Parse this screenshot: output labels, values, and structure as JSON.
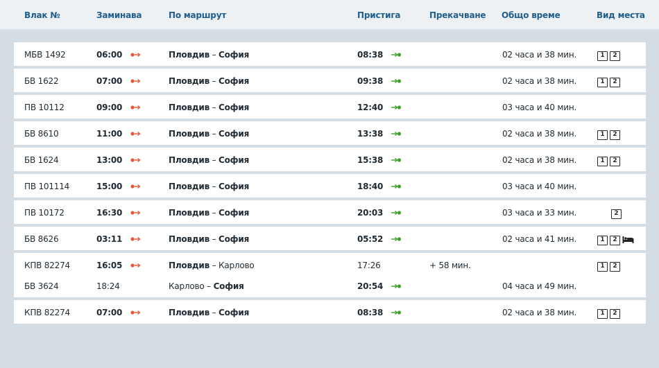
{
  "header": {
    "train": "Влак №",
    "departure": "Заминава",
    "route": "По маршрут",
    "arrival": "Пристига",
    "transfer": "Прекачване",
    "total_time": "Общо време",
    "seat_type": "Вид места"
  },
  "colors": {
    "header_text": "#1e5d8c",
    "depart_icon": "#e8553a",
    "arrive_icon": "#3fa028",
    "background": "#d5dde4"
  },
  "icons": {
    "depart": "departure-dot-arrow-icon",
    "arrive": "arrival-arrow-dot-icon",
    "bed": "sleeper-bed-icon"
  },
  "rows": [
    {
      "train": "МБВ 1492",
      "dep": "06:00",
      "route_from": "Пловдив",
      "route_sep": " – ",
      "route_to": "София",
      "arr": "08:38",
      "transfer": "",
      "total": "02 часа и 38 мин.",
      "seats": [
        "1",
        "2"
      ],
      "bed": false
    },
    {
      "train": "БВ 1622",
      "dep": "07:00",
      "route_from": "Пловдив",
      "route_sep": " – ",
      "route_to": "София",
      "arr": "09:38",
      "transfer": "",
      "total": "02 часа и 38 мин.",
      "seats": [
        "1",
        "2"
      ],
      "bed": false
    },
    {
      "train": "ПВ 10112",
      "dep": "09:00",
      "route_from": "Пловдив",
      "route_sep": " – ",
      "route_to": "София",
      "arr": "12:40",
      "transfer": "",
      "total": "03 часа и 40 мин.",
      "seats": [],
      "bed": false
    },
    {
      "train": "БВ 8610",
      "dep": "11:00",
      "route_from": "Пловдив",
      "route_sep": " – ",
      "route_to": "София",
      "arr": "13:38",
      "transfer": "",
      "total": "02 часа и 38 мин.",
      "seats": [
        "1",
        "2"
      ],
      "bed": false
    },
    {
      "train": "БВ 1624",
      "dep": "13:00",
      "route_from": "Пловдив",
      "route_sep": " – ",
      "route_to": "София",
      "arr": "15:38",
      "transfer": "",
      "total": "02 часа и 38 мин.",
      "seats": [
        "1",
        "2"
      ],
      "bed": false
    },
    {
      "train": "ПВ 101114",
      "dep": "15:00",
      "route_from": "Пловдив",
      "route_sep": " – ",
      "route_to": "София",
      "arr": "18:40",
      "transfer": "",
      "total": "03 часа и 40 мин.",
      "seats": [],
      "bed": false
    },
    {
      "train": "ПВ 10172",
      "dep": "16:30",
      "route_from": "Пловдив",
      "route_sep": " – ",
      "route_to": "София",
      "arr": "20:03",
      "transfer": "",
      "total": "03 часа и 33 мин.",
      "seats": [
        "2"
      ],
      "bed": false
    },
    {
      "train": "БВ 8626",
      "dep": "03:11",
      "route_from": "Пловдив",
      "route_sep": " – ",
      "route_to": "София",
      "arr": "05:52",
      "transfer": "",
      "total": "02 часа и 41 мин.",
      "seats": [
        "1",
        "2"
      ],
      "bed": true
    }
  ],
  "transfer_row": {
    "leg1": {
      "train": "КПВ 82274",
      "dep": "16:05",
      "route_from": "Пловдив",
      "route_sep": " – ",
      "route_to": "Карлово",
      "arr": "17:26",
      "transfer": "+ 58 мин.",
      "seats": [
        "1",
        "2"
      ]
    },
    "leg2": {
      "train": "БВ 3624",
      "dep": "18:24",
      "route_from": "Карлово",
      "route_sep": " – ",
      "route_to": "София",
      "arr": "20:54",
      "total": "04 часа и 49 мин."
    }
  },
  "last_row": {
    "train": "КПВ 82274",
    "dep": "07:00",
    "route_from": "Пловдив",
    "route_sep": " – ",
    "route_to": "София",
    "arr": "08:38",
    "transfer": "",
    "total": "02 часа и 38 мин.",
    "seats": [
      "1",
      "2"
    ]
  }
}
